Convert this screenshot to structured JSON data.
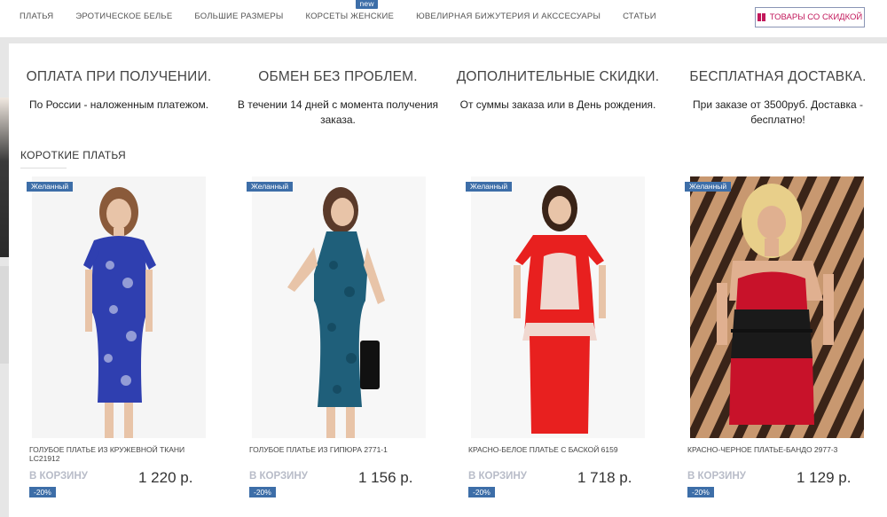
{
  "nav": {
    "items": [
      {
        "label": "ПЛАТЬЯ"
      },
      {
        "label": "ЭРОТИЧЕСКОЕ БЕЛЬЕ"
      },
      {
        "label": "БОЛЬШИЕ РАЗМЕРЫ"
      },
      {
        "label": "КОРСЕТЫ ЖЕНСКИЕ",
        "badge": "new"
      },
      {
        "label": "ЮВЕЛИРНАЯ БИЖУТЕРИЯ И АКССЕСУАРЫ"
      },
      {
        "label": "СТАТЬИ"
      }
    ],
    "sale_button": "ТОВАРЫ СО СКИДКОЙ"
  },
  "features": [
    {
      "title": "ОПЛАТА ПРИ ПОЛУЧЕНИИ.",
      "text": "По России - наложенным платежом."
    },
    {
      "title": "ОБМЕН БЕЗ ПРОБЛЕМ.",
      "text": "В течении 14 дней с момента получения заказа."
    },
    {
      "title": "ДОПОЛНИТЕЛЬНЫЕ СКИДКИ.",
      "text": "От суммы заказа или в День рождения."
    },
    {
      "title": "БЕСПЛАТНАЯ ДОСТАВКА.",
      "text": "При заказе от 3500руб. Доставка - бесплатно!"
    }
  ],
  "section": {
    "title": "КОРОТКИЕ ПЛАТЬЯ"
  },
  "products": [
    {
      "tag": "Желанный",
      "name": "ГОЛУБОЕ ПЛАТЬЕ ИЗ КРУЖЕВНОЙ ТКАНИ LC21912",
      "cart": "В КОРЗИНУ",
      "discount": "-20%",
      "price": "1 220 р."
    },
    {
      "tag": "Желанный",
      "name": "ГОЛУБОЕ ПЛАТЬЕ ИЗ ГИПЮРА 2771-1",
      "cart": "В КОРЗИНУ",
      "discount": "-20%",
      "price": "1 156 р."
    },
    {
      "tag": "Желанный",
      "name": "КРАСНО-БЕЛОЕ ПЛАТЬЕ С БАСКОЙ 6159",
      "cart": "В КОРЗИНУ",
      "discount": "-20%",
      "price": "1 718 р."
    },
    {
      "tag": "Желанный",
      "name": "КРАСНО-ЧЕРНОЕ ПЛАТЬЕ-БАНДО 2977-3",
      "cart": "В КОРЗИНУ",
      "discount": "-20%",
      "price": "1 129 р."
    }
  ],
  "colors": {
    "accent_blue": "#3d6ea8",
    "sale_pink": "#c2185b",
    "dress_blue": "#2f3fb0",
    "dress_teal": "#1f5f7a",
    "dress_red": "#e8201f"
  }
}
